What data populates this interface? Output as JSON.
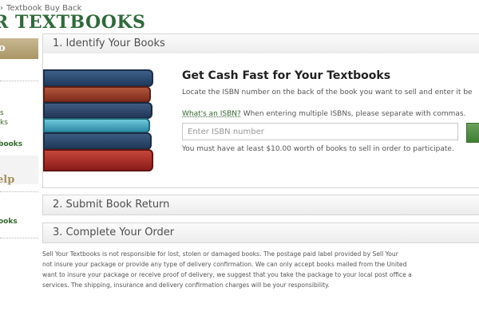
{
  "breadcrumb": {
    "separator": "›",
    "current": "Textbook Buy Back"
  },
  "page": {
    "title": "R TEXTBOOKS"
  },
  "sidebar": {
    "header": "o",
    "items": [
      {
        "label": "s"
      },
      {
        "label": "ks"
      }
    ],
    "link1": "books",
    "help_title": "elp",
    "link2": "ooks"
  },
  "steps": [
    {
      "title": "1. Identify Your Books"
    },
    {
      "title": "2. Submit Book Return"
    },
    {
      "title": "3. Complete Your Order"
    }
  ],
  "identify": {
    "heading": "Get Cash Fast for Your Textbooks",
    "intro": "Locate the ISBN number on the back of the book you want to sell and enter it be",
    "isbn_link": "What's an ISBN?",
    "isbn_note": "When entering multiple ISBNs, please separate with commas.",
    "input_placeholder": "Enter ISBN number",
    "minimum_note": "You must have at least $10.00 worth of books to sell in order to participate."
  },
  "disclaimer": {
    "lines": [
      "Sell Your Textbooks is not responsible for lost, stolen or damaged books. The postage paid label provided by Sell Your",
      "not insure your package or provide any type of delivery confirmation. We can only accept books mailed from the United",
      "want to insure your package or receive proof of delivery, we suggest that you take the package to your local post office a",
      "services. The shipping, insurance and delivery confirmation charges will be your responsibility."
    ]
  },
  "colors": {
    "brand_green": "#2f6b3a",
    "link_green": "#2e6b2a",
    "sidebar_tan": "#a99566",
    "button_green": "#4a8a3c"
  },
  "icons": {
    "books_illustration": "stacked-books-image"
  }
}
